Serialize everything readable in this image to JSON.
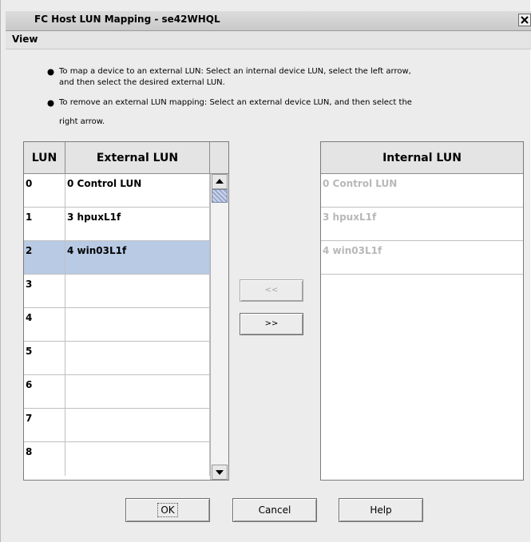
{
  "window": {
    "title": "FC Host LUN Mapping - se42WHQL"
  },
  "menu": {
    "view": "View"
  },
  "instructions": [
    "To map a device to an external LUN: Select an internal device LUN, select the left arrow,",
    "and then select the desired external LUN.",
    "To remove an external LUN mapping: Select an external device LUN, and then select the",
    "right arrow."
  ],
  "external_table": {
    "headers": {
      "lun": "LUN",
      "external": "External LUN"
    },
    "rows": [
      {
        "lun": "0",
        "external": "0 Control LUN"
      },
      {
        "lun": "1",
        "external": "3  hpuxL1f"
      },
      {
        "lun": "2",
        "external": "4  win03L1f"
      },
      {
        "lun": "3",
        "external": ""
      },
      {
        "lun": "4",
        "external": ""
      },
      {
        "lun": "5",
        "external": ""
      },
      {
        "lun": "6",
        "external": ""
      },
      {
        "lun": "7",
        "external": ""
      },
      {
        "lun": "8",
        "external": ""
      }
    ],
    "selected_row": "2"
  },
  "internal_table": {
    "header": "Internal LUN",
    "rows": [
      "0 Control LUN",
      "3  hpuxL1f",
      "4  win03L1f"
    ]
  },
  "arrows": {
    "left": "<<",
    "right": ">>"
  },
  "buttons": {
    "ok": "OK",
    "cancel": "Cancel",
    "help": "Help"
  },
  "colors": {
    "selection": "#b9cae4",
    "disabled_text": "#b8b8b8"
  }
}
